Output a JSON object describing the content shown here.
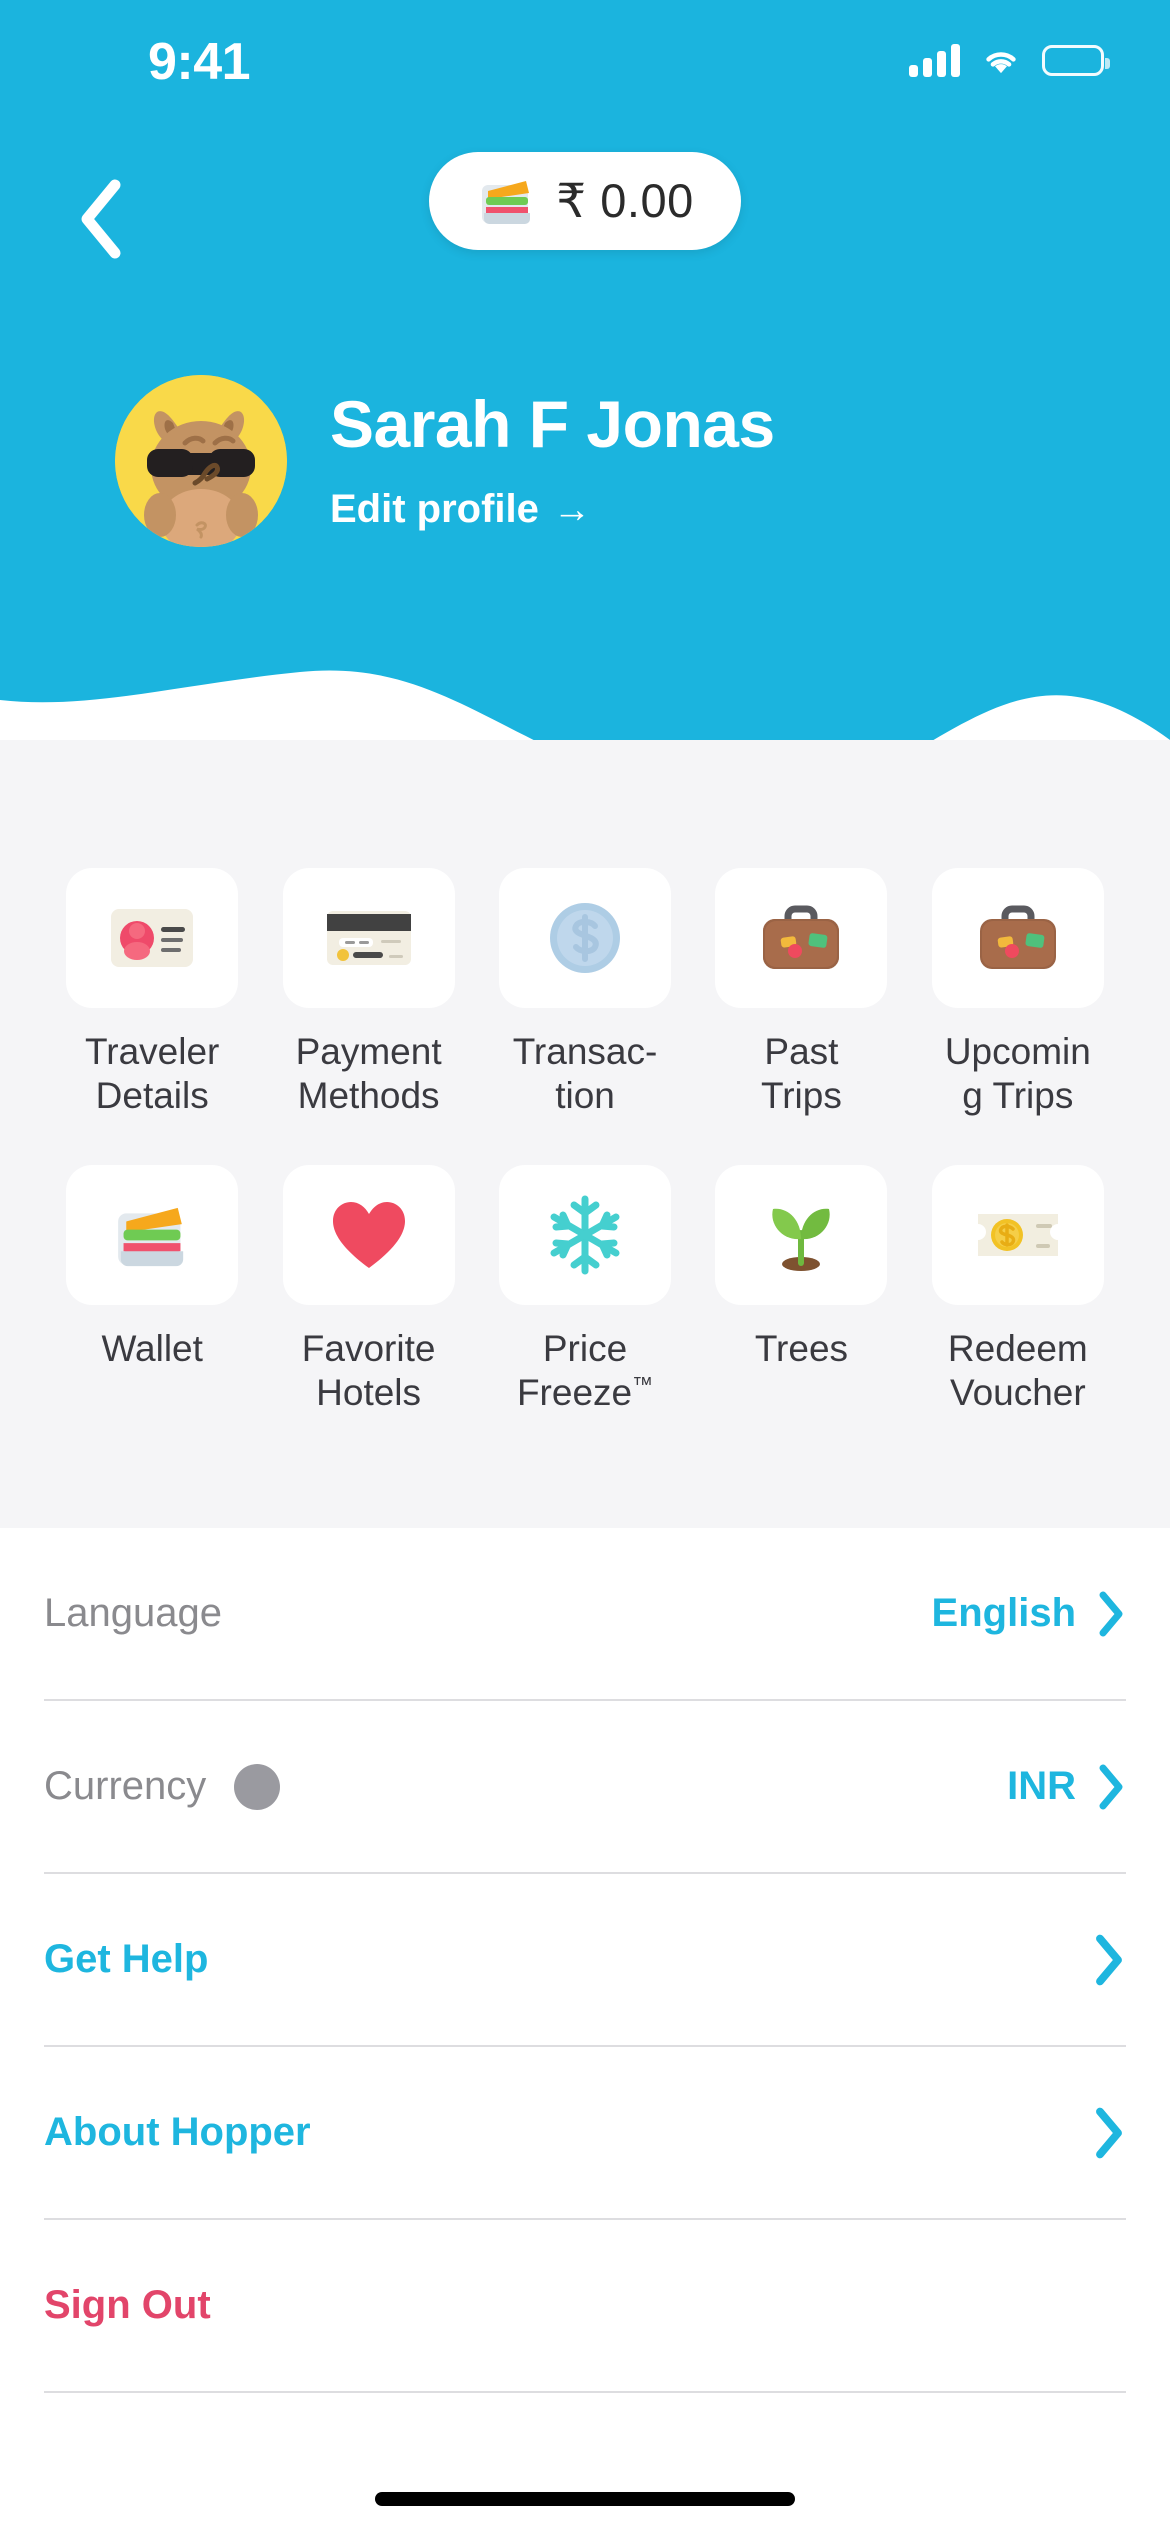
{
  "colors": {
    "brand_blue": "#1BB4DE",
    "accent_cyan": "#1EB6DF",
    "danger_pink": "#E2456A",
    "section_bg": "#F5F5F7",
    "card_white": "#FFFFFF",
    "label_gray": "#8A8A8E"
  },
  "status_bar": {
    "time": "9:41",
    "cellular_icon": "cellular-signal-icon",
    "wifi_icon": "wifi-icon",
    "battery_icon": "battery-icon"
  },
  "nav": {
    "back_icon": "back-chevron-icon",
    "balance": {
      "icon": "wallet-icon",
      "amount": "₹ 0.00"
    }
  },
  "profile": {
    "avatar_icon": "bunny-avatar-icon",
    "name": "Sarah F Jonas",
    "edit_label": "Edit profile",
    "edit_arrow": "→"
  },
  "grid": {
    "rows": [
      [
        {
          "label": "Traveler Details",
          "icon": "id-card-icon"
        },
        {
          "label": "Payment Methods",
          "icon": "credit-card-icon"
        },
        {
          "label": "Transac-tion",
          "icon": "dollar-coin-icon"
        },
        {
          "label": "Past Trips",
          "icon": "suitcase-icon"
        },
        {
          "label": "Upcoming Trips",
          "icon": "suitcase-icon"
        }
      ],
      [
        {
          "label": "Wallet",
          "icon": "wallet-icon"
        },
        {
          "label": "Favorite Hotels",
          "icon": "heart-icon"
        },
        {
          "label": "Price Freeze",
          "icon": "snowflake-icon",
          "superscript": "™"
        },
        {
          "label": "Trees",
          "icon": "seedling-icon"
        },
        {
          "label": "Redeem Voucher",
          "icon": "voucher-icon"
        }
      ]
    ]
  },
  "settings": {
    "language": {
      "label": "Language",
      "value": "English",
      "chevron": "chevron-right-icon"
    },
    "currency": {
      "label": "Currency",
      "value": "INR",
      "chevron": "chevron-right-icon",
      "loading_dot": true
    },
    "get_help": {
      "label": "Get Help",
      "chevron": "chevron-right-icon"
    },
    "about": {
      "label": "About Hopper",
      "chevron": "chevron-right-icon"
    },
    "sign_out": {
      "label": "Sign Out"
    }
  }
}
